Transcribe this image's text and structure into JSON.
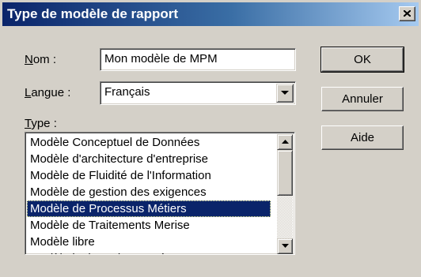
{
  "window": {
    "title": "Type de modèle de rapport",
    "close_glyph": "close-icon"
  },
  "form": {
    "name_label_accel": "N",
    "name_label_rest": "om :",
    "name_value": "Mon  modèle de MPM",
    "language_label_accel": "L",
    "language_label_rest": "angue :",
    "language_value": "Français",
    "type_label_accel": "T",
    "type_label_rest": "ype :"
  },
  "type_list": {
    "items": [
      "Modèle Conceptuel de Données",
      "Modèle d'architecture d'entreprise",
      "Modèle de Fluidité de l'Information",
      "Modèle de gestion des exigences",
      "Modèle de Processus Métiers",
      "Modèle de Traitements Merise",
      "Modèle libre",
      "Modèle logique de Données"
    ],
    "selected_index": 4
  },
  "buttons": {
    "ok": "OK",
    "cancel": "Annuler",
    "help": "Aide"
  },
  "colors": {
    "titlebar_start": "#0a246a",
    "titlebar_end": "#a6caf0",
    "selection": "#0a246a",
    "face": "#d4d0c8"
  }
}
